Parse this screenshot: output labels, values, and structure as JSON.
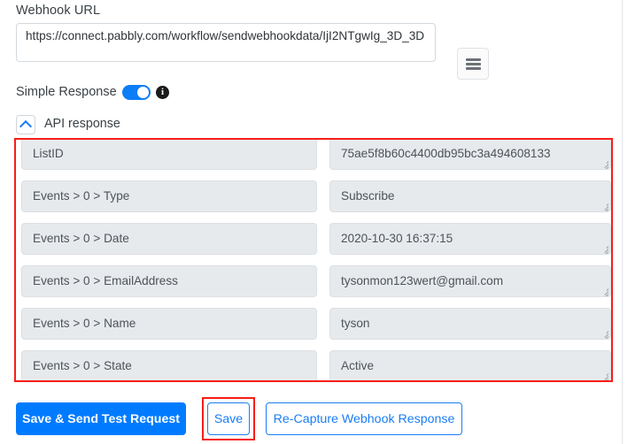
{
  "webhook": {
    "label": "Webhook URL",
    "url": "https://connect.pabbly.com/workflow/sendwebhookdata/IjI2NTgwIg_3D_3D",
    "menu_icon": "hamburger-menu-icon"
  },
  "simple_response": {
    "label": "Simple Response",
    "toggle_state": "on",
    "info_icon": "info-icon"
  },
  "api_response": {
    "title": "API response",
    "collapse_icon": "chevron-up-icon",
    "fields": [
      {
        "key": "ListID",
        "value": "75ae5f8b60c4400db95bc3a494608133"
      },
      {
        "key": "Events > 0 > Type",
        "value": "Subscribe"
      },
      {
        "key": "Events > 0 > Date",
        "value": "2020-10-30 16:37:15"
      },
      {
        "key": "Events > 0 > EmailAddress",
        "value": "tysonmon123wert@gmail.com"
      },
      {
        "key": "Events > 0 > Name",
        "value": "tyson"
      },
      {
        "key": "Events > 0 > State",
        "value": "Active"
      }
    ]
  },
  "buttons": {
    "save_and_send": "Save & Send Test Request",
    "save": "Save",
    "recapture": "Re-Capture Webhook Response"
  },
  "colors": {
    "primary_blue": "#007bff",
    "toggle_blue": "#0d7ef5",
    "highlight_red": "#f71e17",
    "field_bg": "#e7eaed"
  }
}
